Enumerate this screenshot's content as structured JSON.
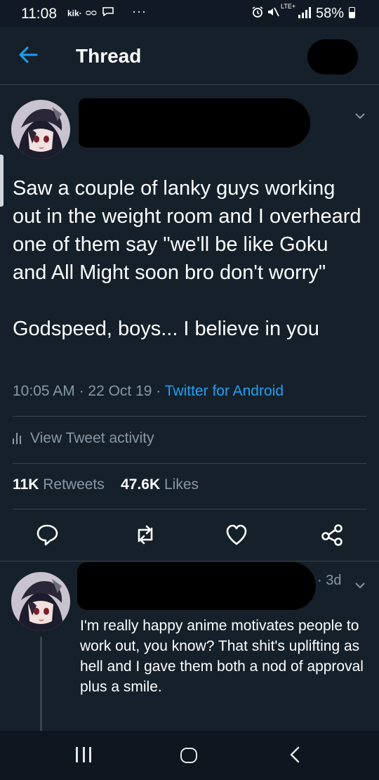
{
  "status_bar": {
    "time": "11:08",
    "app_label": "kik·",
    "voicemail": "ᴑᴑ",
    "more": "···",
    "network": "LTE+",
    "battery": "58%"
  },
  "header": {
    "title": "Thread"
  },
  "tweet": {
    "text": "Saw a couple of lanky guys working out in the weight room and I overheard one of them say \"we'll be like Goku and All Might soon bro don't worry\"\n\nGodspeed, boys... I believe in you",
    "time": "10:05 AM",
    "sep1": " · ",
    "date": "22 Oct 19",
    "sep2": " · ",
    "source": "Twitter for Android",
    "activity_label": "View Tweet activity",
    "retweets_count": "11K",
    "retweets_label": "Retweets",
    "likes_count": "47.6K",
    "likes_label": "Likes"
  },
  "reply": {
    "time": "· 3d",
    "text": "I'm really happy anime motivates people to work out, you know? That shit's uplifting as hell and I gave them both a nod of approval plus a smile."
  },
  "colors": {
    "background": "#15202b",
    "accent": "#1da1f2",
    "secondary_text": "#8899a6",
    "divider": "#38444d"
  },
  "icons": {
    "back": "arrow-left-icon",
    "menu": "chevron-down-icon",
    "reply": "reply-icon",
    "retweet": "retweet-icon",
    "like": "heart-icon",
    "share": "share-icon"
  }
}
